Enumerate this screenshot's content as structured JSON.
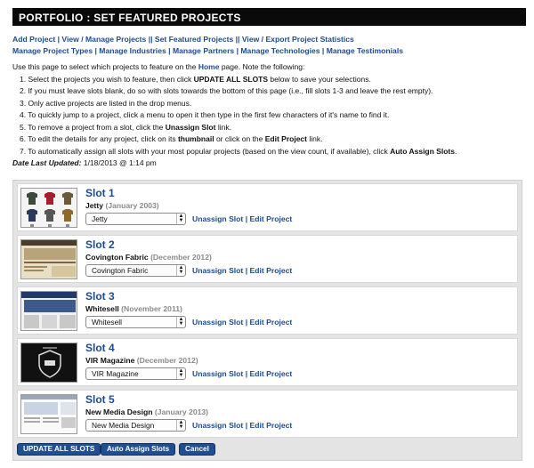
{
  "header": {
    "title": "PORTFOLIO : SET FEATURED PROJECTS"
  },
  "nav": {
    "add_project": "Add Project",
    "view_manage_projects": "View / Manage Projects",
    "set_featured_projects": "Set Featured Projects",
    "view_export_stats": "View / Export Project Statistics",
    "manage_project_types": "Manage Project Types",
    "manage_industries": "Manage Industries",
    "manage_partners": "Manage Partners",
    "manage_technologies": "Manage Technologies",
    "manage_testimonials": "Manage Testimonials"
  },
  "intro": {
    "before": "Use this page to select which projects to feature on the ",
    "home": "Home",
    "after": " page. Note the following:",
    "steps": [
      {
        "a": "1.  Select the projects you wish to feature, then click ",
        "b": "UPDATE ALL SLOTS",
        "c": " below to save your selections."
      },
      {
        "a": "2.  If you must leave slots blank, do so with slots towards the bottom of this page (i.e., fill slots 1-3 and leave the rest empty).",
        "b": "",
        "c": ""
      },
      {
        "a": "3.  Only active projects are listed in the drop menus.",
        "b": "",
        "c": ""
      },
      {
        "a": "4.  To quickly jump to a project, click a menu to open it then type in the first few characters of it's name to find it.",
        "b": "",
        "c": ""
      },
      {
        "a": "5.  To remove a project from a slot, click the ",
        "b": "Unassign Slot",
        "c": " link."
      },
      {
        "a": "6.  To edit the details for any project, click on its ",
        "b": "thumbnail",
        "c": " or click on the ",
        "d": "Edit Project",
        "e": " link."
      },
      {
        "a": "7.  To automatically assign all slots with your most popular projects (based on the view count, if available), click ",
        "b": "Auto Assign Slots",
        "c": "."
      }
    ],
    "date_label": "Date Last Updated:",
    "date_value": "1/18/2013 @ 1:14 pm"
  },
  "slots": [
    {
      "title": "Slot 1",
      "project": "Jetty",
      "when": "(January 2003)",
      "selected": "Jetty"
    },
    {
      "title": "Slot 2",
      "project": "Covington Fabric",
      "when": "(December 2012)",
      "selected": "Covington Fabric"
    },
    {
      "title": "Slot 3",
      "project": "Whitesell",
      "when": "(November 2011)",
      "selected": "Whitesell"
    },
    {
      "title": "Slot 4",
      "project": "VIR Magazine",
      "when": "(December 2012)",
      "selected": "VIR Magazine"
    },
    {
      "title": "Slot 5",
      "project": "New Media Design",
      "when": "(January 2013)",
      "selected": "New Media Design"
    }
  ],
  "slot_actions": {
    "unassign": "Unassign Slot",
    "sep": "|",
    "edit": "Edit Project"
  },
  "buttons": {
    "update_all": "UPDATE ALL SLOTS",
    "auto_assign": "Auto Assign Slots",
    "cancel": "Cancel"
  },
  "colors": {
    "link": "#1c4b8f",
    "header_bg": "#0a0a0a",
    "button_bg": "#1f4e91"
  }
}
